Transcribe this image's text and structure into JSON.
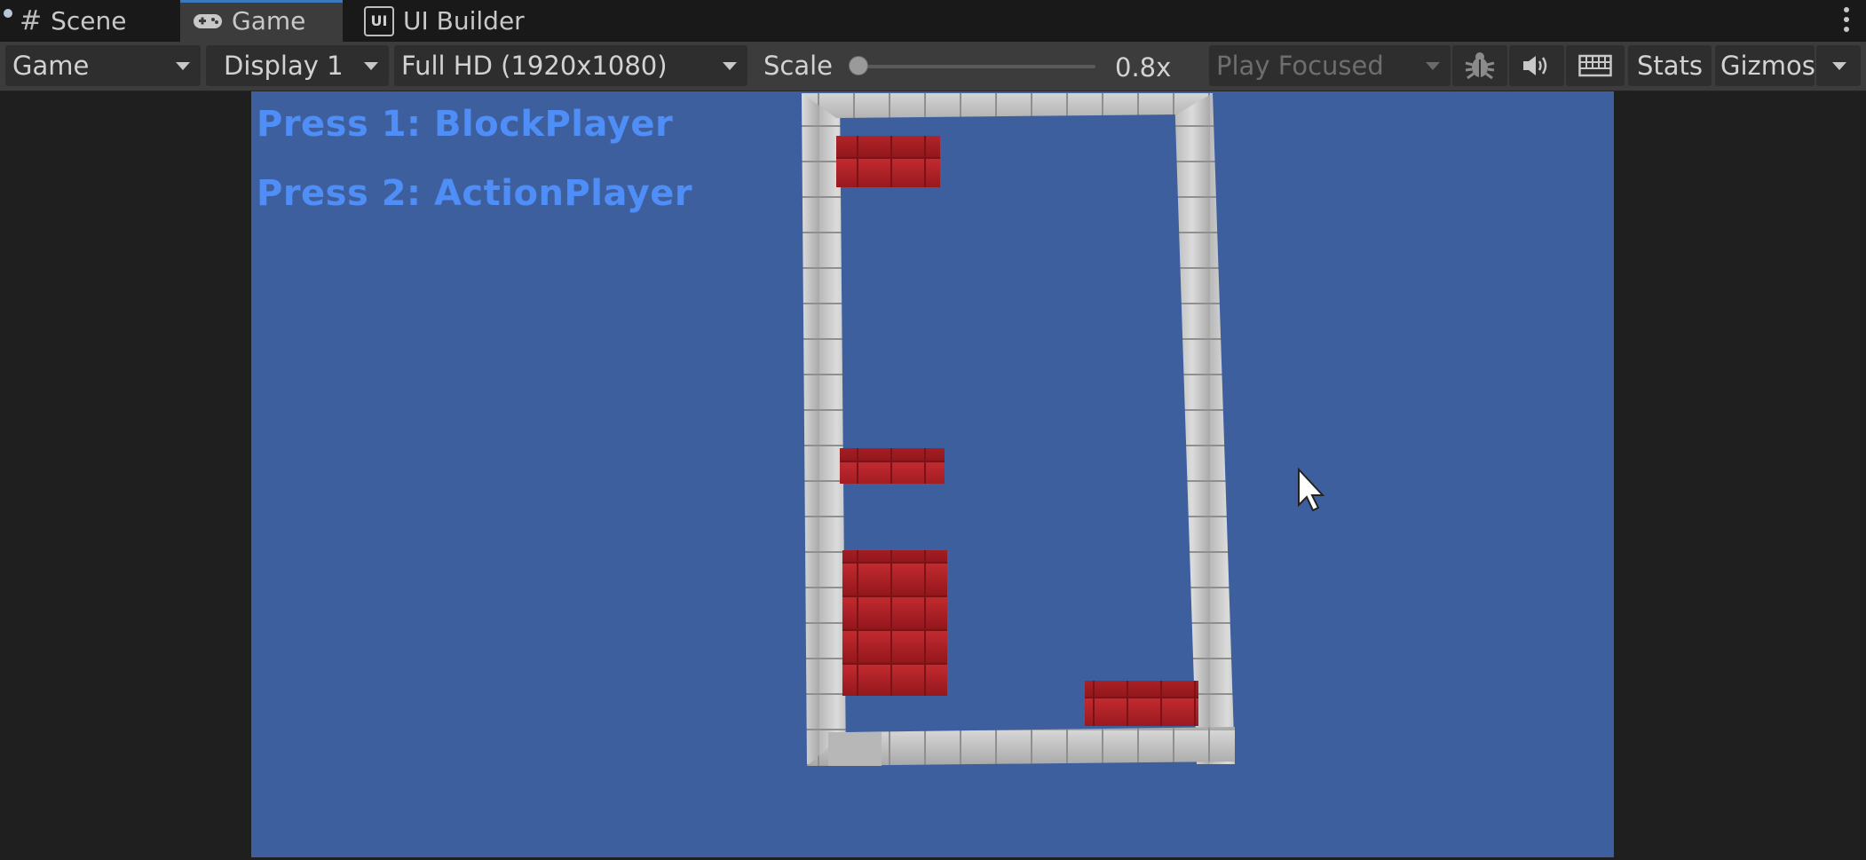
{
  "tabs": [
    {
      "label": "Scene",
      "icon": "hash-icon"
    },
    {
      "label": "Game",
      "icon": "gamepad-icon",
      "active": true
    },
    {
      "label": "UI Builder",
      "icon": "ui-builder-icon",
      "icon_text": "UI"
    }
  ],
  "toolbar": {
    "view_mode": "Game",
    "display": "Display 1",
    "resolution": "Full HD (1920x1080)",
    "scale_label": "Scale",
    "scale_value": "0.8x",
    "scale_level": 0.0,
    "play_mode": "Play Focused",
    "stats": "Stats",
    "gizmos": "Gizmos"
  },
  "game": {
    "hud_line_1": "Press 1: BlockPlayer",
    "hud_line_2": "Press 2: ActionPlayer",
    "background_color": "#3e5f9e",
    "hud_color": "#4f8ef7",
    "wall_color": "#c8c8c8",
    "block_color": "#a51f24"
  }
}
